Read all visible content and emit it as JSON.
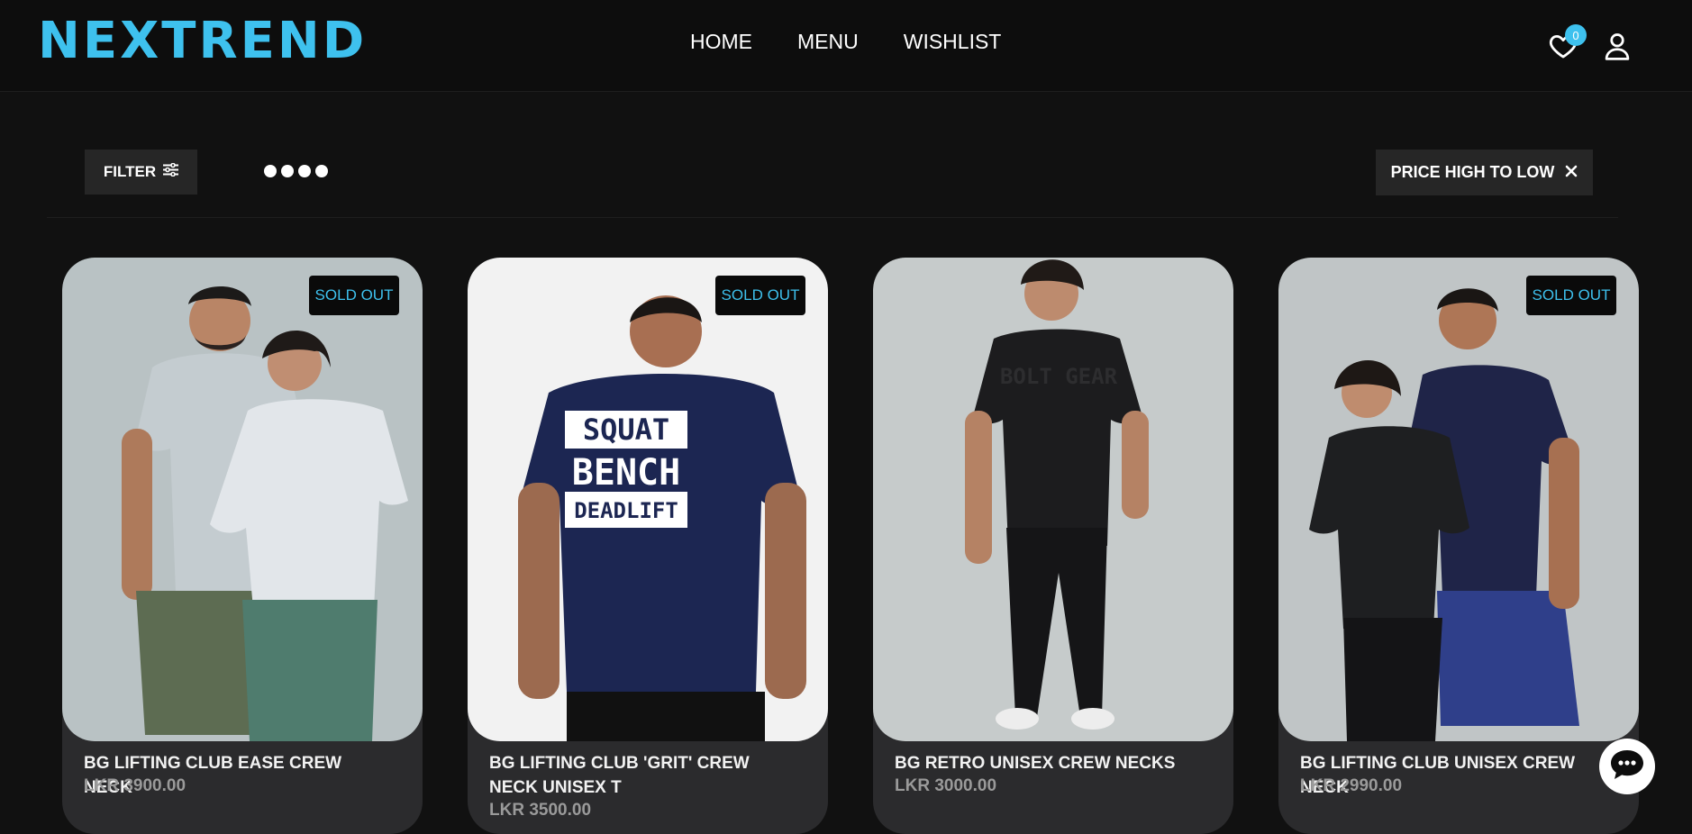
{
  "brand": {
    "logo": "NEXTREND",
    "accent_color": "#3ec1ee"
  },
  "nav": {
    "items": [
      {
        "label": "HOME"
      },
      {
        "label": "MENU"
      },
      {
        "label": "WISHLIST"
      }
    ]
  },
  "header_icons": {
    "wishlist_icon": "heart-icon",
    "wishlist_count": "0",
    "account_icon": "user-icon"
  },
  "toolbar": {
    "filter_label": "FILTER",
    "filter_icon": "sliders-icon",
    "grid_icon": "dots-grid-icon",
    "sort_label": "PRICE HIGH TO LOW",
    "sort_clear_icon": "close-icon"
  },
  "products": [
    {
      "title": "BG LIFTING CLUB EASE CREW NECK",
      "price": "LKR 3900.00",
      "badge": "SOLD OUT"
    },
    {
      "title": "BG LIFTING CLUB 'GRIT' CREW NECK UNISEX T",
      "price": "LKR 3500.00",
      "badge": "SOLD OUT",
      "print": [
        "SQUAT",
        "BENCH",
        "DEADLIFT"
      ]
    },
    {
      "title": "BG RETRO UNISEX CREW NECKS",
      "price": "LKR 3000.00",
      "badge": ""
    },
    {
      "title": "BG LIFTING CLUB UNISEX CREW NECK",
      "price": "LKR 2990.00",
      "badge": "SOLD OUT"
    }
  ],
  "chat": {
    "icon": "chat-bubble-icon"
  }
}
